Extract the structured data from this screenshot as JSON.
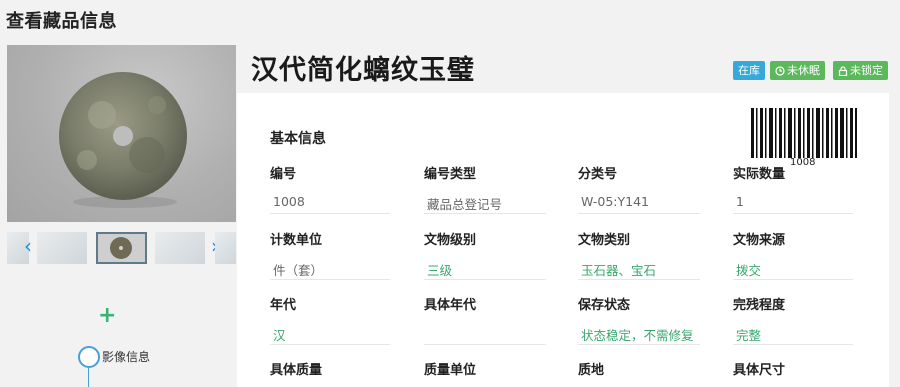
{
  "page": {
    "heading": "查看藏品信息"
  },
  "item": {
    "title": "汉代简化螭纹玉璧"
  },
  "badges": [
    {
      "label": "在库",
      "icon": "",
      "color": "#36a9d8"
    },
    {
      "label": "未休眠",
      "icon": "clock-icon",
      "color": "#5cb85c"
    },
    {
      "label": "未锁定",
      "icon": "lock-icon",
      "color": "#5cb85c"
    }
  ],
  "section": {
    "title": "基本信息"
  },
  "barcode": {
    "value": "1008"
  },
  "fields": [
    {
      "label": "编号",
      "value": "1008"
    },
    {
      "label": "编号类型",
      "value": "藏品总登记号"
    },
    {
      "label": "分类号",
      "value": "W-05:Y141"
    },
    {
      "label": "实际数量",
      "value": "1"
    },
    {
      "label": "计数单位",
      "value": "件（套）"
    },
    {
      "label": "文物级别",
      "value": "三级"
    },
    {
      "label": "文物类别",
      "value": "玉石器、宝石"
    },
    {
      "label": "文物来源",
      "value": "拨交"
    },
    {
      "label": "年代",
      "value": "汉"
    },
    {
      "label": "具体年代",
      "value": ""
    },
    {
      "label": "保存状态",
      "value": "状态稳定，不需修复"
    },
    {
      "label": "完残程度",
      "value": "完整"
    },
    {
      "label": "具体质量",
      "value": ""
    },
    {
      "label": "质量单位",
      "value": ""
    },
    {
      "label": "质地",
      "value": ""
    },
    {
      "label": "具体尺寸",
      "value": ""
    }
  ],
  "sidebar": {
    "timeline_label": "影像信息",
    "add_icon": "plus-icon",
    "prev_icon": "chevron-left-icon",
    "next_icon": "chevron-right-icon"
  },
  "colors": {
    "accent_green": "#3aa76d",
    "badge_blue": "#36a9d8",
    "badge_green": "#5cb85c",
    "link_blue": "#1e8fe0"
  }
}
